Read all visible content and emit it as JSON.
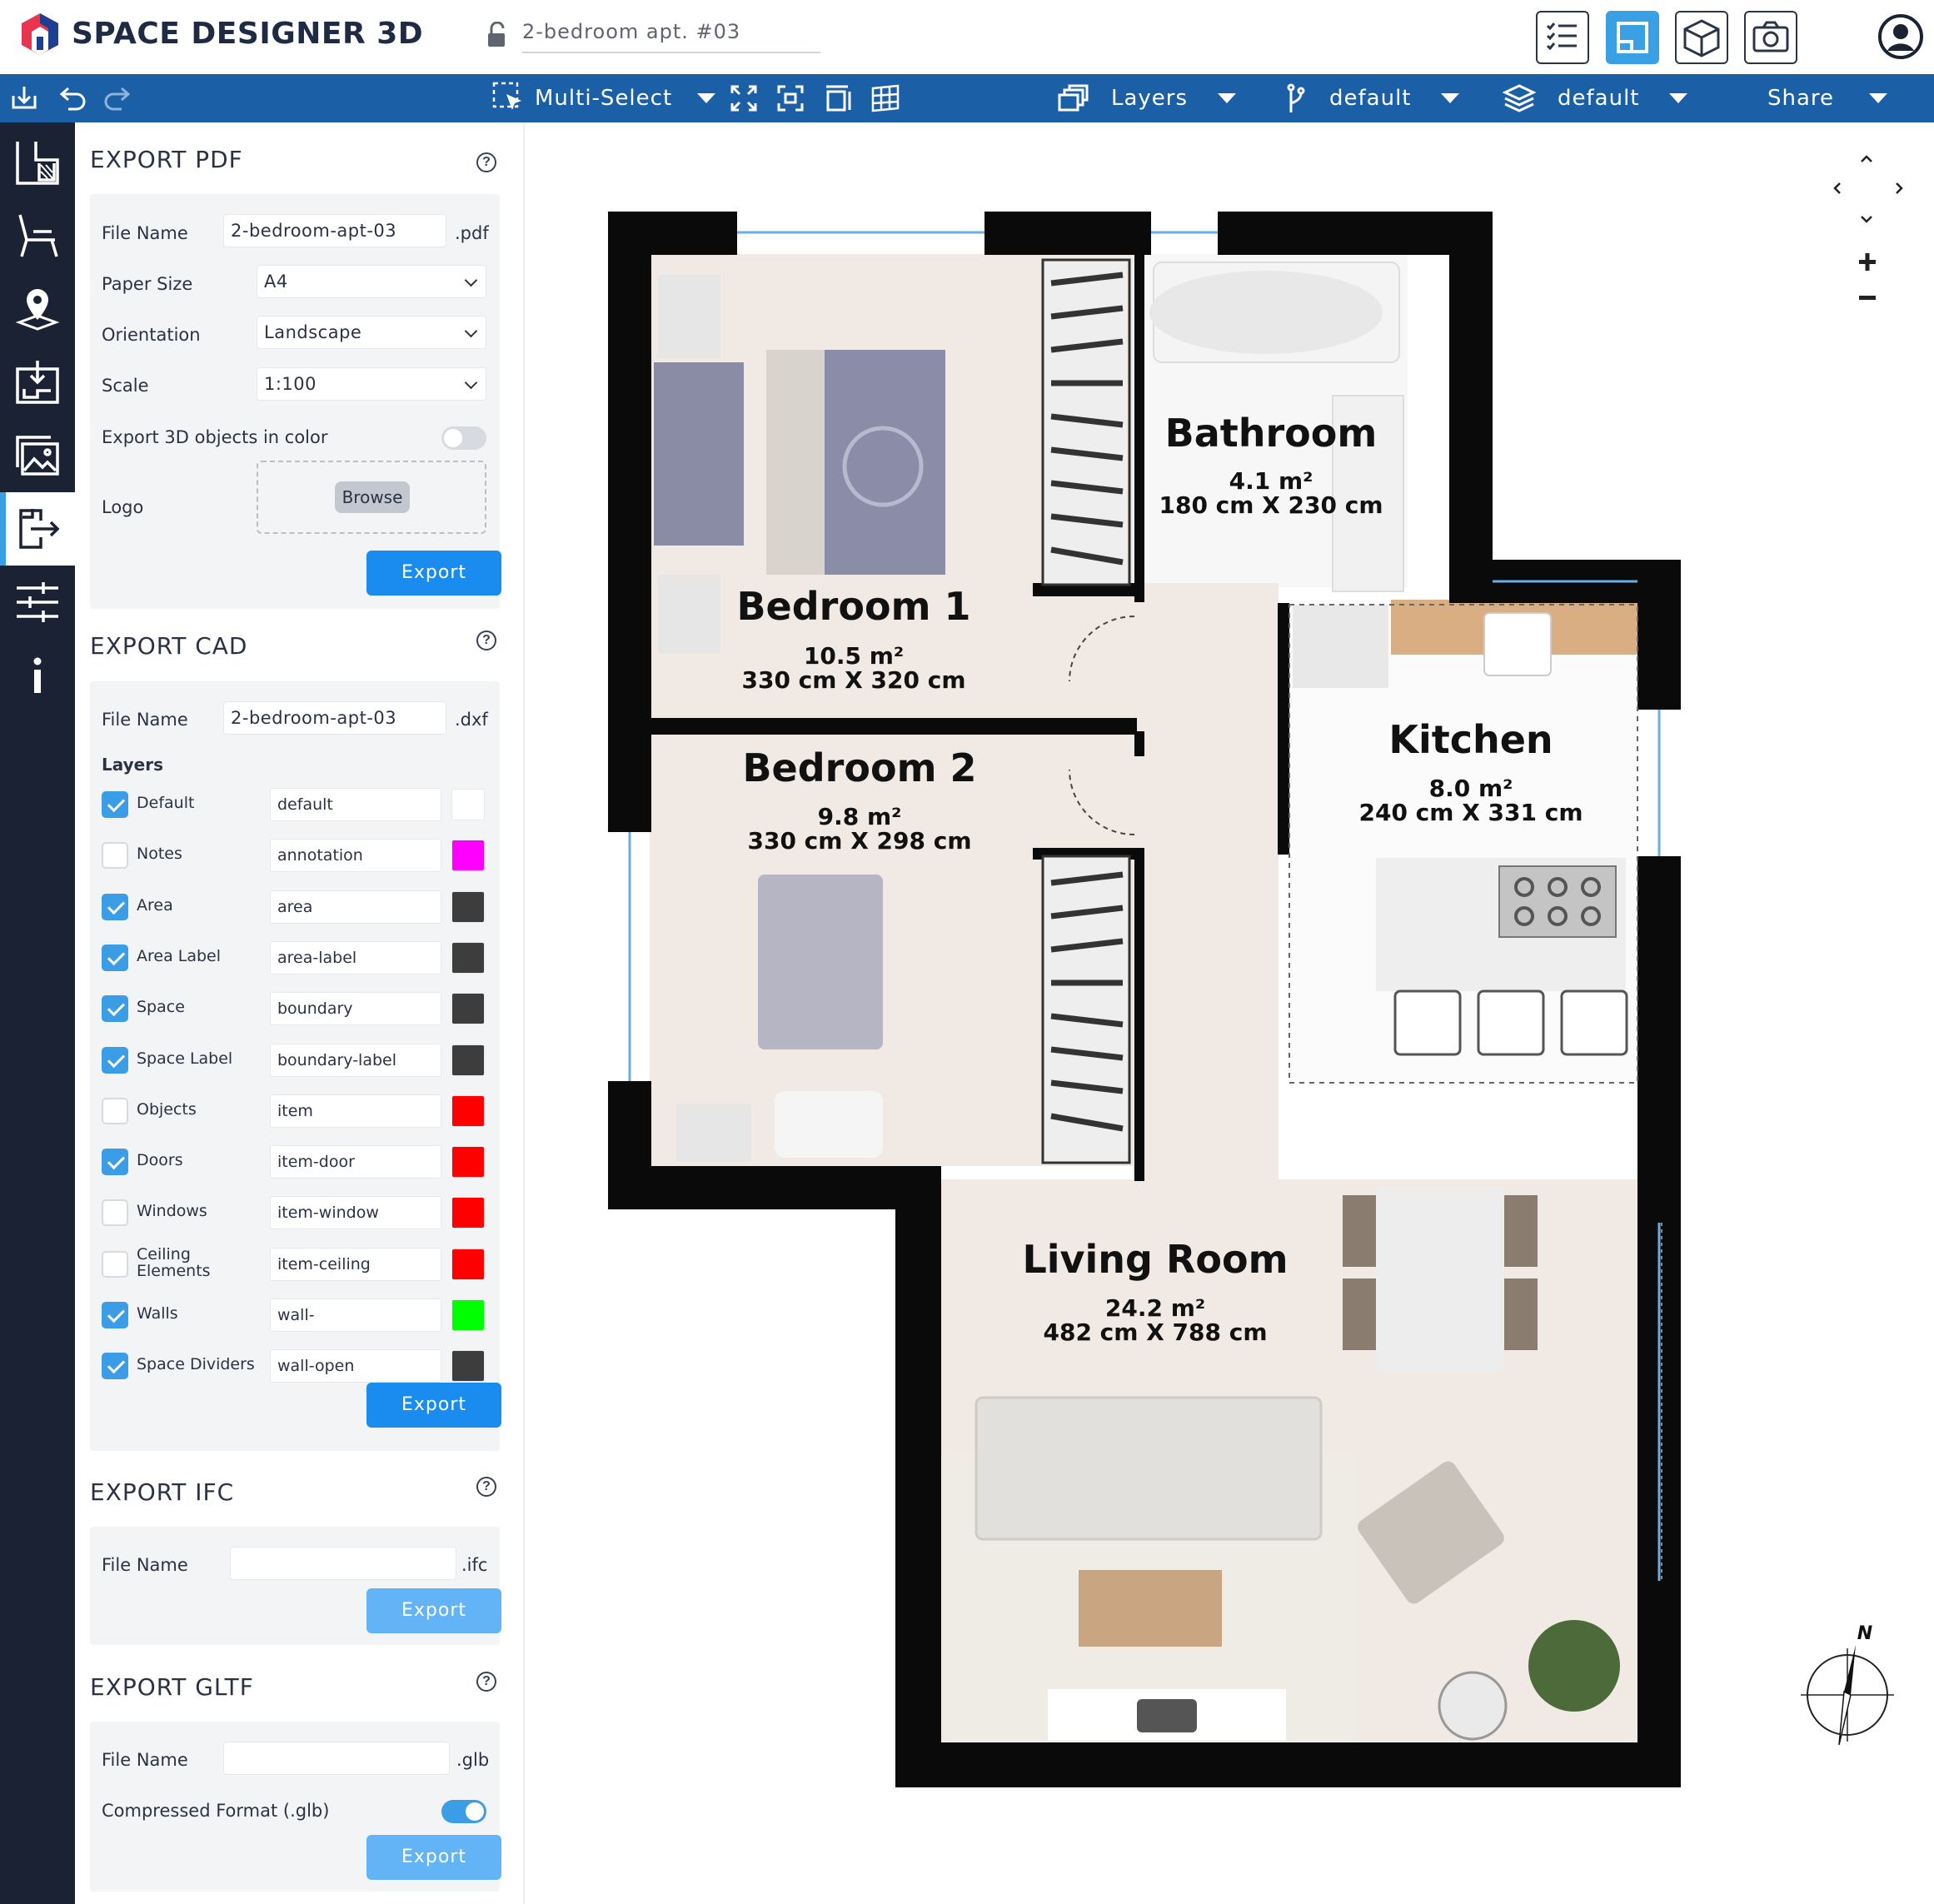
{
  "app": {
    "brand": "SPACE DESIGNER 3D",
    "project_name": "2-bedroom apt. #03"
  },
  "toolbar": {
    "multiselect_label": "Multi-Select",
    "layers_label": "Layers",
    "level_label": "default",
    "layer_set_label": "default",
    "share_label": "Share"
  },
  "panel": {
    "pdf": {
      "title": "EXPORT PDF",
      "file_name_label": "File Name",
      "file_name_value": "2-bedroom-apt-03",
      "file_ext": ".pdf",
      "paper_size_label": "Paper Size",
      "paper_size_value": "A4",
      "orientation_label": "Orientation",
      "orientation_value": "Landscape",
      "scale_label": "Scale",
      "scale_value": "1:100",
      "color_label": "Export 3D objects in color",
      "color_on": false,
      "logo_label": "Logo",
      "browse_label": "Browse",
      "export_label": "Export"
    },
    "cad": {
      "title": "EXPORT CAD",
      "file_name_label": "File Name",
      "file_name_value": "2-bedroom-apt-03",
      "file_ext": ".dxf",
      "layers_label": "Layers",
      "layers": [
        {
          "name": "Default",
          "value": "default",
          "color": "#ffffff",
          "checked": true
        },
        {
          "name": "Notes",
          "value": "annotation",
          "color": "#ff00ff",
          "checked": false
        },
        {
          "name": "Area",
          "value": "area",
          "color": "#3d3d3d",
          "checked": true
        },
        {
          "name": "Area Label",
          "value": "area-label",
          "color": "#3d3d3d",
          "checked": true
        },
        {
          "name": "Space",
          "value": "boundary",
          "color": "#3d3d3d",
          "checked": true
        },
        {
          "name": "Space Label",
          "value": "boundary-label",
          "color": "#3d3d3d",
          "checked": true
        },
        {
          "name": "Objects",
          "value": "item",
          "color": "#ff0000",
          "checked": false
        },
        {
          "name": "Doors",
          "value": "item-door",
          "color": "#ff0000",
          "checked": true
        },
        {
          "name": "Windows",
          "value": "item-window",
          "color": "#ff0000",
          "checked": false
        },
        {
          "name": "Ceiling Elements",
          "value": "item-ceiling",
          "color": "#ff0000",
          "checked": false
        },
        {
          "name": "Walls",
          "value": "wall-",
          "color": "#00ff00",
          "checked": true
        },
        {
          "name": "Space Dividers",
          "value": "wall-open",
          "color": "#3d3d3d",
          "checked": true
        }
      ],
      "export_label": "Export"
    },
    "ifc": {
      "title": "EXPORT IFC",
      "file_name_label": "File Name",
      "file_name_value": "",
      "file_ext": ".ifc",
      "export_label": "Export"
    },
    "gltf": {
      "title": "EXPORT GLTF",
      "file_name_label": "File Name",
      "file_name_value": "",
      "file_ext": ".glb",
      "compressed_label": "Compressed Format (.glb)",
      "compressed_on": true,
      "export_label": "Export"
    }
  },
  "floorplan": {
    "rooms": [
      {
        "name": "Bedroom 1",
        "area": "10.5 m²",
        "dims": "330 cm X 320 cm"
      },
      {
        "name": "Bathroom",
        "area": "4.1 m²",
        "dims": "180 cm X 230 cm"
      },
      {
        "name": "Kitchen",
        "area": "8.0 m²",
        "dims": "240 cm X 331 cm"
      },
      {
        "name": "Bedroom 2",
        "area": "9.8 m²",
        "dims": "330 cm X 298 cm"
      },
      {
        "name": "Living Room",
        "area": "24.2 m²",
        "dims": "482 cm X 788 cm"
      }
    ],
    "compass_label": "N"
  },
  "colors": {
    "toolbar_bg": "#1b5fa6",
    "rail_bg": "#1a2233",
    "accent": "#1a8cf0",
    "wall": "#0a0a0a",
    "floor": "#f1e9e4"
  }
}
